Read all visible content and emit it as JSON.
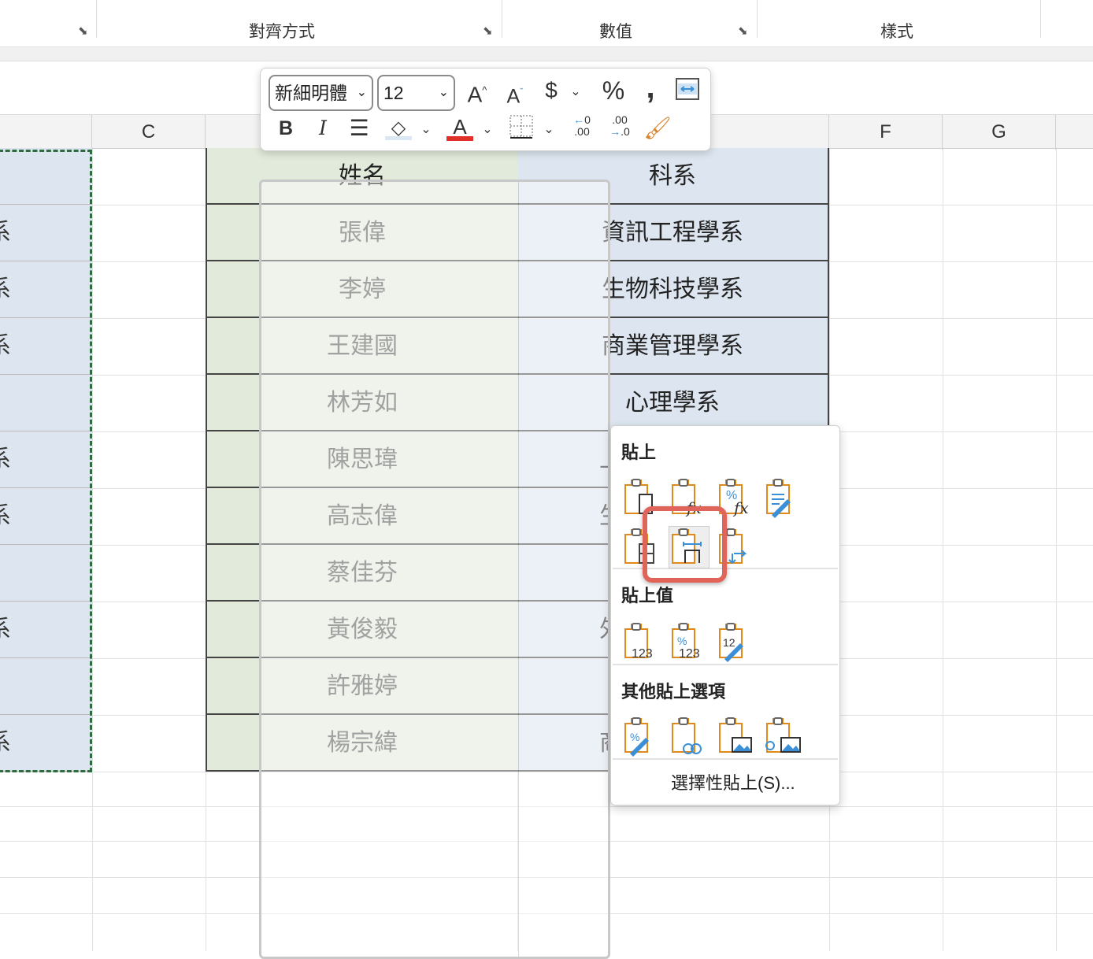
{
  "ribbon": {
    "groups": [
      "對齊方式",
      "數值",
      "樣式"
    ]
  },
  "columns": [
    "C",
    "F",
    "G"
  ],
  "table": {
    "headers": {
      "name": "姓名",
      "dept": "科系"
    },
    "rows": [
      {
        "name": "張偉",
        "dept": "資訊工程學系"
      },
      {
        "name": "李婷",
        "dept": "生物科技學系"
      },
      {
        "name": "王建國",
        "dept": "商業管理學系"
      },
      {
        "name": "林芳如",
        "dept": "心理學系"
      },
      {
        "name": "陳思瑋",
        "dept": "上"
      },
      {
        "name": "高志偉",
        "dept": "生"
      },
      {
        "name": "蔡佳芬",
        "dept": ""
      },
      {
        "name": "黃俊毅",
        "dept": "外"
      },
      {
        "name": "許雅婷",
        "dept": ""
      },
      {
        "name": "楊宗緯",
        "dept": "商"
      }
    ],
    "left_col_fragments": [
      "",
      "系",
      "系",
      "系",
      "",
      "系",
      "系",
      "",
      "系",
      "",
      "系"
    ]
  },
  "mini_toolbar": {
    "font": "新細明體",
    "size": "12"
  },
  "paste_menu": {
    "paste_header": "貼上",
    "paste_values_header": "貼上值",
    "other_header": "其他貼上選項",
    "special": "選擇性貼上(S)...",
    "icon_labels": {
      "formulas": "fx",
      "pct": "%",
      "v123": "123"
    }
  }
}
